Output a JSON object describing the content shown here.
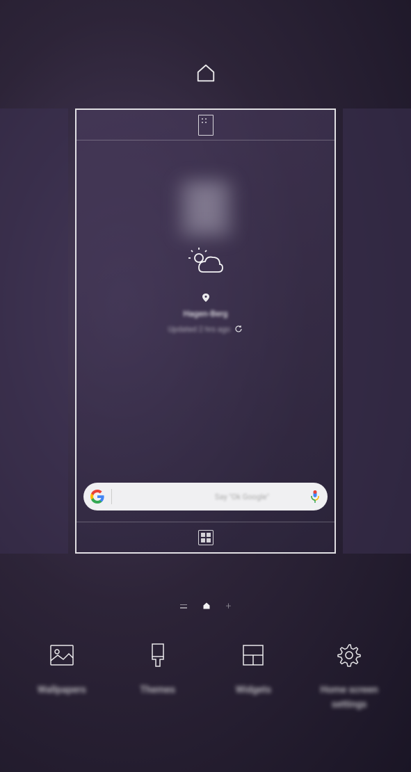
{
  "home_icon": "home",
  "panel": {
    "top_icon": "panel-grid",
    "bottom_icon": "apps-grid",
    "weather": {
      "icon": "partly-cloudy",
      "location_pin": "pin",
      "location_text": "Hagen-Berg",
      "update_text": "Updated 2 hrs ago",
      "refresh_icon": "refresh"
    },
    "search": {
      "logo": "google",
      "placeholder": "Say \"Ok Google\"",
      "mic_icon": "mic"
    }
  },
  "page_indicators": {
    "left": "bixby-lines",
    "center": "home-small",
    "right": "+"
  },
  "options": [
    {
      "icon": "image",
      "label": "Wallpapers"
    },
    {
      "icon": "brush",
      "label": "Themes"
    },
    {
      "icon": "widgets",
      "label": "Widgets"
    },
    {
      "icon": "gear",
      "label": "Home screen settings"
    }
  ]
}
